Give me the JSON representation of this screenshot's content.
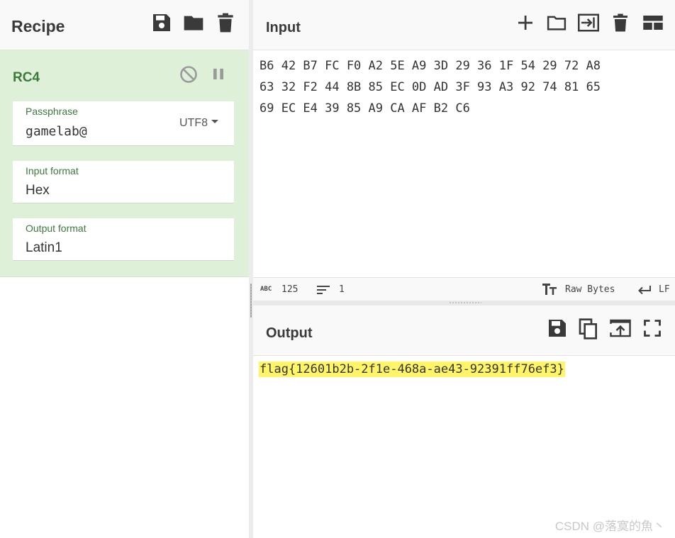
{
  "recipe": {
    "title": "Recipe",
    "operation": {
      "name": "RC4",
      "args": {
        "passphrase": {
          "label": "Passphrase",
          "value": "gamelab@",
          "encoding": "UTF8"
        },
        "input_format": {
          "label": "Input format",
          "value": "Hex"
        },
        "output_format": {
          "label": "Output format",
          "value": "Latin1"
        }
      }
    },
    "icons": [
      "save-icon",
      "folder-icon",
      "trash-icon",
      "disable-icon",
      "pause-icon"
    ]
  },
  "input": {
    "title": "Input",
    "text": "B6 42 B7 FC F0 A2 5E A9 3D 29 36 1F 54 29 72 A8\n63 32 F2 44 8B 85 EC 0D AD 3F 93 A3 92 74 81 65\n69 EC E4 39 85 A9 CA AF B2 C6",
    "status": {
      "length_icon": "ABC",
      "length": "125",
      "lines": "1",
      "charset": "Raw Bytes",
      "eol": "LF"
    },
    "icons": [
      "plus-icon",
      "folder-icon",
      "import-icon",
      "trash-icon",
      "layout-icon"
    ]
  },
  "output": {
    "title": "Output",
    "text": "flag{12601b2b-2f1e-468a-ae43-92391ff76ef3}",
    "icons": [
      "save-icon",
      "copy-icon",
      "replace-input-icon",
      "fullscreen-icon"
    ]
  },
  "watermark": "CSDN @落寞的魚丶",
  "colors": {
    "operation_bg": "#dff0d8",
    "operation_text": "#3c7a3a",
    "highlight": "#fff566"
  }
}
